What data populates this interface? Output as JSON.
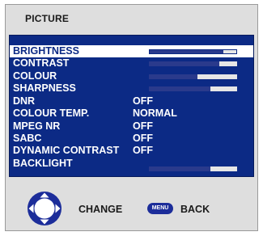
{
  "menu": {
    "title": "PICTURE",
    "items": [
      {
        "label": "BRIGHTNESS",
        "type": "slider",
        "level": 0.85,
        "selected": true
      },
      {
        "label": "CONTRAST",
        "type": "slider",
        "level": 0.8
      },
      {
        "label": "COLOUR",
        "type": "slider",
        "level": 0.55
      },
      {
        "label": "SHARPNESS",
        "type": "slider",
        "level": 0.7
      },
      {
        "label": "DNR",
        "type": "value",
        "value": "OFF"
      },
      {
        "label": "COLOUR TEMP.",
        "type": "value",
        "value": "NORMAL"
      },
      {
        "label": "MPEG NR",
        "type": "value",
        "value": "OFF"
      },
      {
        "label": "SABC",
        "type": "value",
        "value": "OFF"
      },
      {
        "label": "DYNAMIC CONTRAST",
        "type": "value",
        "value": "OFF"
      },
      {
        "label": "BACKLIGHT",
        "type": "slider",
        "level": 0.7
      }
    ]
  },
  "footer": {
    "change_label": "CHANGE",
    "menu_key": "MENU",
    "back_label": "BACK"
  },
  "colors": {
    "panel": "#0c2a85",
    "bar_fill": "#2a3a8c",
    "bar_track": "#e6e6e6",
    "menu_key": "#1c2d9a"
  }
}
